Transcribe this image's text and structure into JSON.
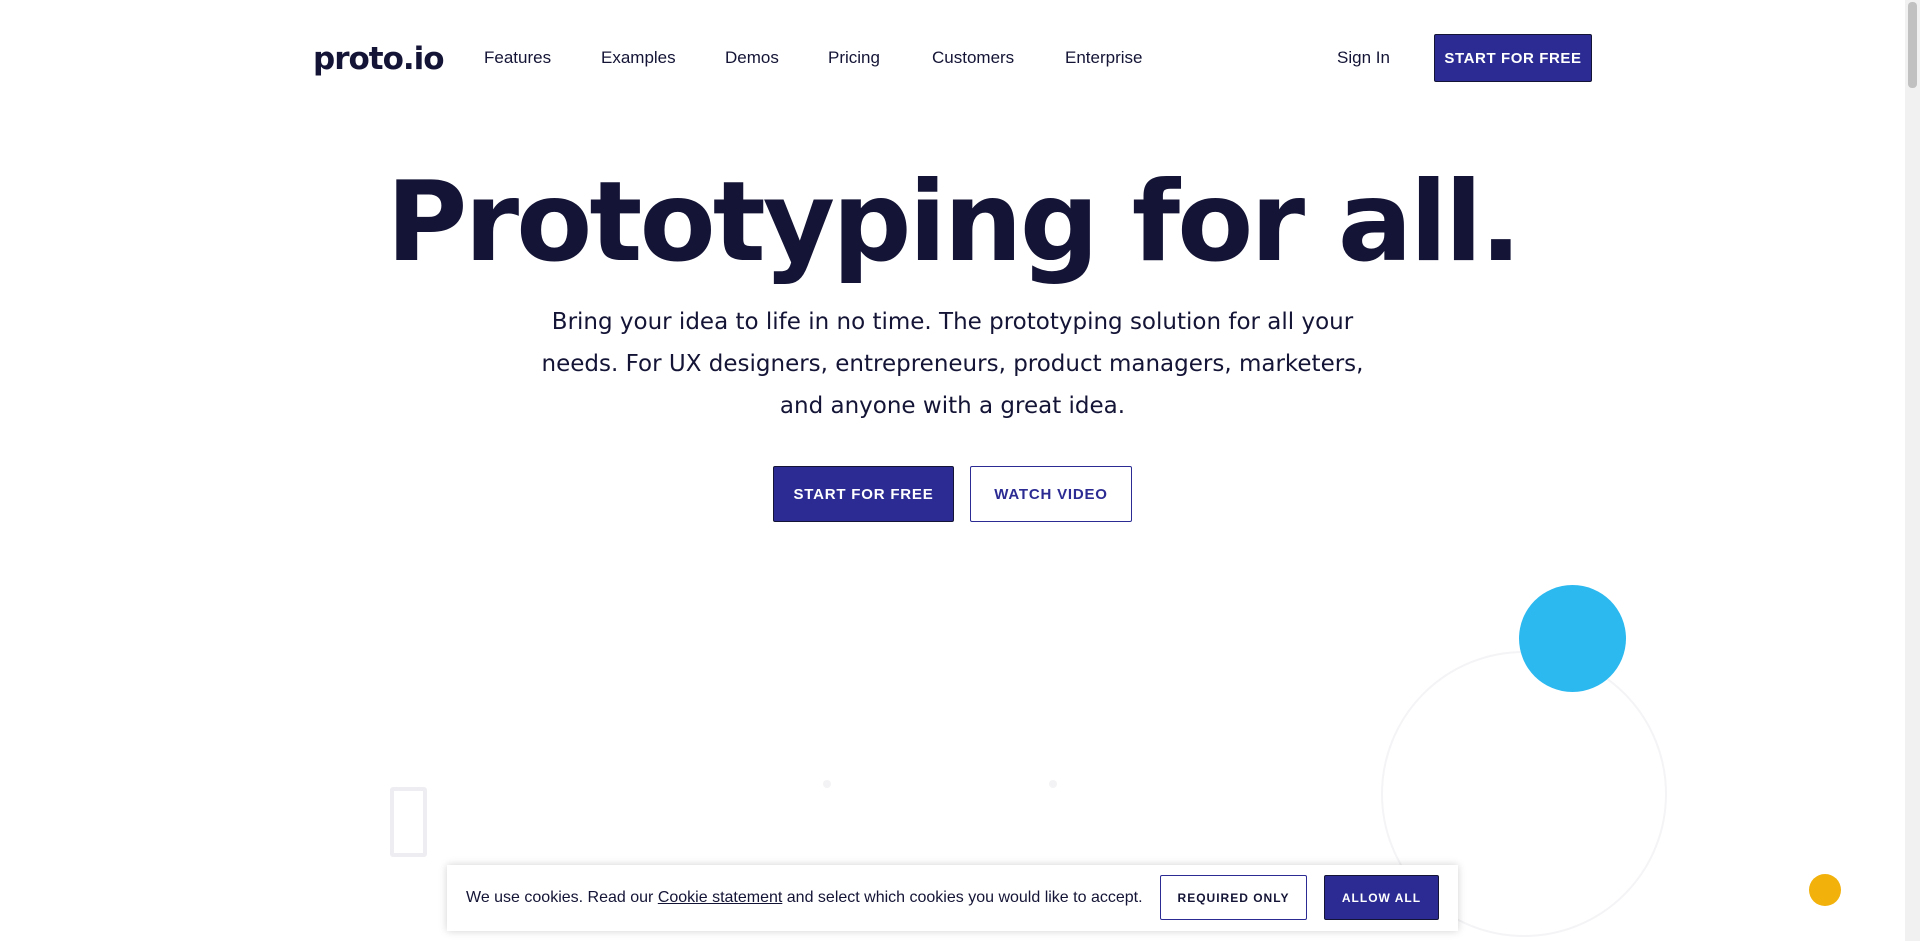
{
  "header": {
    "logo": "proto.io",
    "nav": [
      {
        "label": "Features"
      },
      {
        "label": "Examples"
      },
      {
        "label": "Demos"
      },
      {
        "label": "Pricing"
      },
      {
        "label": "Customers"
      },
      {
        "label": "Enterprise"
      }
    ],
    "sign_in": "Sign In",
    "cta": "START FOR FREE"
  },
  "hero": {
    "title": "Prototyping for all.",
    "subtitle": "Bring your idea to life in no time. The prototyping solution for all your needs. For UX designers, entrepreneurs, product managers, marketers, and anyone with a great idea.",
    "primary_button": "START FOR FREE",
    "secondary_button": "WATCH VIDEO"
  },
  "cookie_banner": {
    "text_before": "We use cookies. Read our ",
    "link": "Cookie statement",
    "text_after": " and select which cookies you would like to accept.",
    "required_only": "REQUIRED ONLY",
    "allow_all": "ALLOW ALL"
  },
  "colors": {
    "brand": "#2b2b93",
    "text": "#141436",
    "accent_blue": "#2cb9f0",
    "accent_yellow": "#f2b10b"
  }
}
